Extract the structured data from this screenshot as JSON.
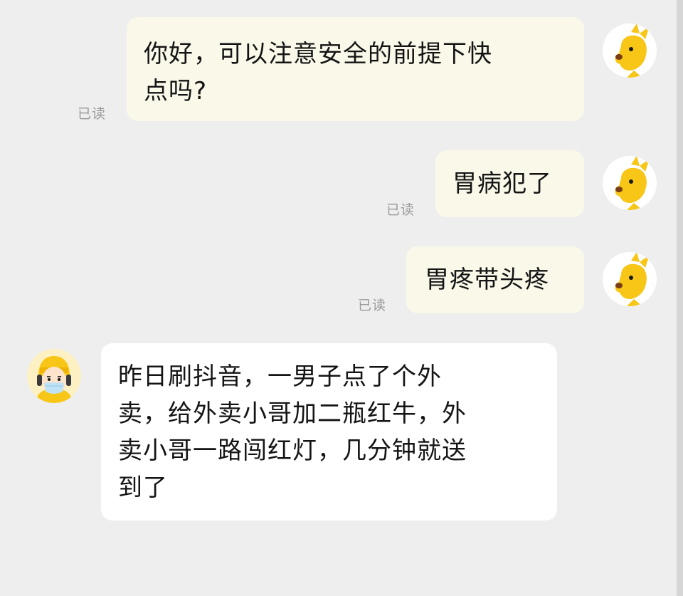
{
  "messages": [
    {
      "side": "out",
      "lines": [
        "你好，可以注意安全的前提下快",
        "点吗?"
      ],
      "status": "已读",
      "avatar": "kangaroo-avatar"
    },
    {
      "side": "out",
      "lines": [
        "胃病犯了"
      ],
      "status": "已读",
      "avatar": "kangaroo-avatar"
    },
    {
      "side": "out",
      "lines": [
        "胃疼带头疼"
      ],
      "status": "已读",
      "avatar": "kangaroo-avatar"
    },
    {
      "side": "in",
      "lines": [
        "昨日刷抖音，一男子点了个外",
        "卖，给外卖小哥加二瓶红牛，外",
        "卖小哥一路闯红灯，几分钟就送",
        "到了"
      ],
      "avatar": "courier-avatar"
    }
  ],
  "colors": {
    "background": "#eeeeee",
    "outgoing_bubble": "#faf8e9",
    "incoming_bubble": "#ffffff",
    "read_status": "#9a9a9a",
    "avatar_yellow": "#f7c617"
  }
}
